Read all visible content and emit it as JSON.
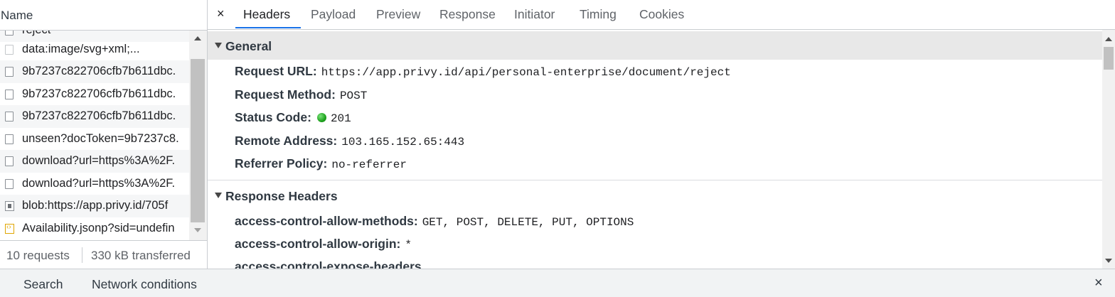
{
  "request_list": {
    "header": "Name",
    "rows": [
      {
        "label": "reject",
        "icon": "checkbox-icon"
      },
      {
        "label": "data:image/svg+xml;...",
        "icon": "checkbox-icon"
      },
      {
        "label": "9b7237c822706cfb7b611dbc.",
        "icon": "checkbox-icon"
      },
      {
        "label": "9b7237c822706cfb7b611dbc.",
        "icon": "checkbox-icon"
      },
      {
        "label": "9b7237c822706cfb7b611dbc.",
        "icon": "checkbox-icon"
      },
      {
        "label": "unseen?docToken=9b7237c8.",
        "icon": "checkbox-icon"
      },
      {
        "label": "download?url=https%3A%2F.",
        "icon": "checkbox-icon"
      },
      {
        "label": "download?url=https%3A%2F.",
        "icon": "checkbox-icon"
      },
      {
        "label": "blob:https://app.privy.id/705f",
        "icon": "blob-file-icon"
      },
      {
        "label": "Availability.jsonp?sid=undefin",
        "icon": "script-file-icon"
      }
    ],
    "status": {
      "requests": "10 requests",
      "transferred": "330 kB transferred"
    }
  },
  "detail": {
    "close_label": "×",
    "tabs": [
      "Headers",
      "Payload",
      "Preview",
      "Response",
      "Initiator",
      "Timing",
      "Cookies"
    ],
    "active_tab": "Headers",
    "general": {
      "title": "General",
      "fields": [
        {
          "key": "Request URL:",
          "value": "https://app.privy.id/api/personal-enterprise/document/reject"
        },
        {
          "key": "Request Method:",
          "value": "POST"
        },
        {
          "key": "Status Code:",
          "value": "201",
          "status_color": "#1ea21e"
        },
        {
          "key": "Remote Address:",
          "value": "103.165.152.65:443"
        },
        {
          "key": "Referrer Policy:",
          "value": "no-referrer"
        }
      ]
    },
    "response_headers": {
      "title": "Response Headers",
      "fields": [
        {
          "key": "access-control-allow-methods:",
          "value": "GET, POST, DELETE, PUT, OPTIONS"
        },
        {
          "key": "access-control-allow-origin:",
          "value": "*"
        },
        {
          "key": "access-control-expose-headers",
          "value": ""
        }
      ]
    }
  },
  "drawer": {
    "tabs": [
      "Search",
      "Network conditions"
    ],
    "close_label": "×"
  },
  "colors": {
    "accent": "#1a73e8",
    "section_header_bg": "#e8e8e8"
  }
}
